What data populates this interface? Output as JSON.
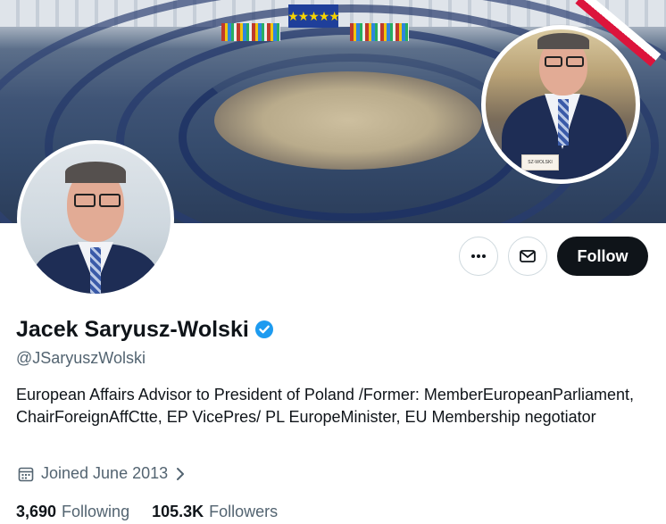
{
  "profile": {
    "display_name": "Jacek Saryusz-Wolski",
    "handle": "@JSaryuszWolski",
    "bio": "European Affairs Advisor to President of Poland /Former: MemberEuropeanParliament, ChairForeignAffCtte, EP VicePres/ PL EuropeMinister, EU Membership negotiator",
    "joined": "Joined June 2013",
    "verified_color": "#1d9bf0"
  },
  "banner": {
    "flag_stars": "★★★★★",
    "nameplate": "SZ-WOLSKI",
    "sash_colors": [
      "#ffffff",
      "#dc143c"
    ]
  },
  "actions": {
    "more_icon": "ellipsis-icon",
    "message_icon": "envelope-icon",
    "follow_label": "Follow"
  },
  "stats": {
    "following_count": "3,690",
    "following_label": "Following",
    "followers_count": "105.3K",
    "followers_label": "Followers"
  },
  "colors": {
    "accent": "#0f1419",
    "secondary_text": "#536471",
    "border": "#cfd9de"
  }
}
